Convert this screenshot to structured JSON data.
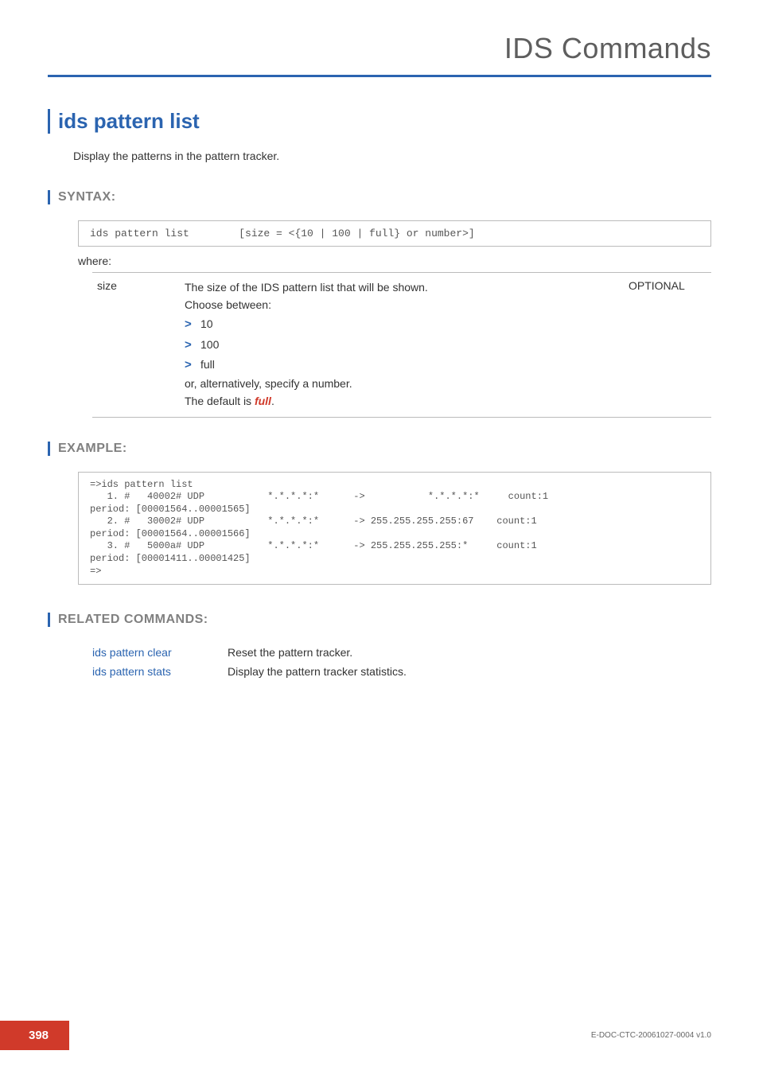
{
  "header": {
    "chapter_title": "IDS Commands"
  },
  "command": {
    "title": "ids pattern list",
    "description": "Display the patterns in the pattern tracker."
  },
  "sections": {
    "syntax_label": "SYNTAX:",
    "example_label": "EXAMPLE:",
    "related_label": "RELATED COMMANDS:"
  },
  "syntax": {
    "line": "ids pattern list        [size = <{10 | 100 | full} or number>]"
  },
  "where_label": "where:",
  "params": {
    "name": "size",
    "opt": "OPTIONAL",
    "desc_intro": "The size of the IDS pattern list that will be shown.",
    "choose_between": "Choose between:",
    "options": [
      "10",
      "100",
      "full"
    ],
    "alt_line": "or, alternatively, specify a number.",
    "default_prefix": "The default is ",
    "default_value": "full",
    "default_suffix": "."
  },
  "example": "=>ids pattern list\n   1. #   40002# UDP           *.*.*.*:*      ->           *.*.*.*:*     count:1\nperiod: [00001564..00001565]\n   2. #   30002# UDP           *.*.*.*:*      -> 255.255.255.255:67    count:1\nperiod: [00001564..00001566]\n   3. #   5000a# UDP           *.*.*.*:*      -> 255.255.255.255:*     count:1\nperiod: [00001411..00001425]\n=>",
  "related": [
    {
      "cmd": "ids pattern clear",
      "desc": "Reset the pattern tracker."
    },
    {
      "cmd": "ids pattern stats",
      "desc": "Display the pattern tracker statistics."
    }
  ],
  "footer": {
    "page_number": "398",
    "doc_id": "E-DOC-CTC-20061027-0004 v1.0"
  }
}
